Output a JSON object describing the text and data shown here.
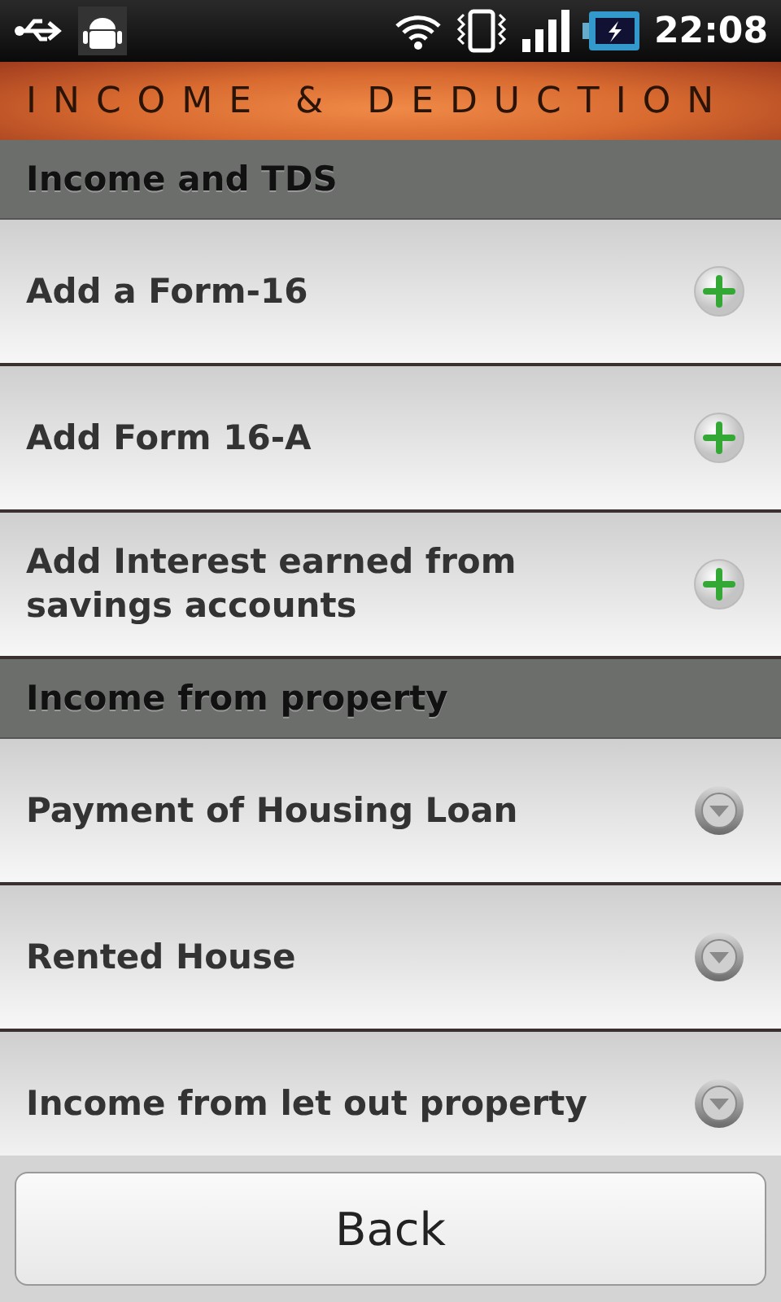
{
  "status_bar": {
    "time": "22:08"
  },
  "title": "INCOME & DEDUCTION",
  "sections": [
    {
      "header": "Income and TDS",
      "items": [
        {
          "label": "Add a Form-16",
          "kind": "add"
        },
        {
          "label": "Add Form 16-A",
          "kind": "add"
        },
        {
          "label": "Add Interest earned from savings accounts",
          "kind": "add"
        }
      ]
    },
    {
      "header": "Income from property",
      "items": [
        {
          "label": "Payment of Housing Loan",
          "kind": "expand"
        },
        {
          "label": "Rented House",
          "kind": "expand"
        },
        {
          "label": "Income from let out property",
          "kind": "expand"
        }
      ]
    }
  ],
  "buttons": [
    "Back"
  ]
}
